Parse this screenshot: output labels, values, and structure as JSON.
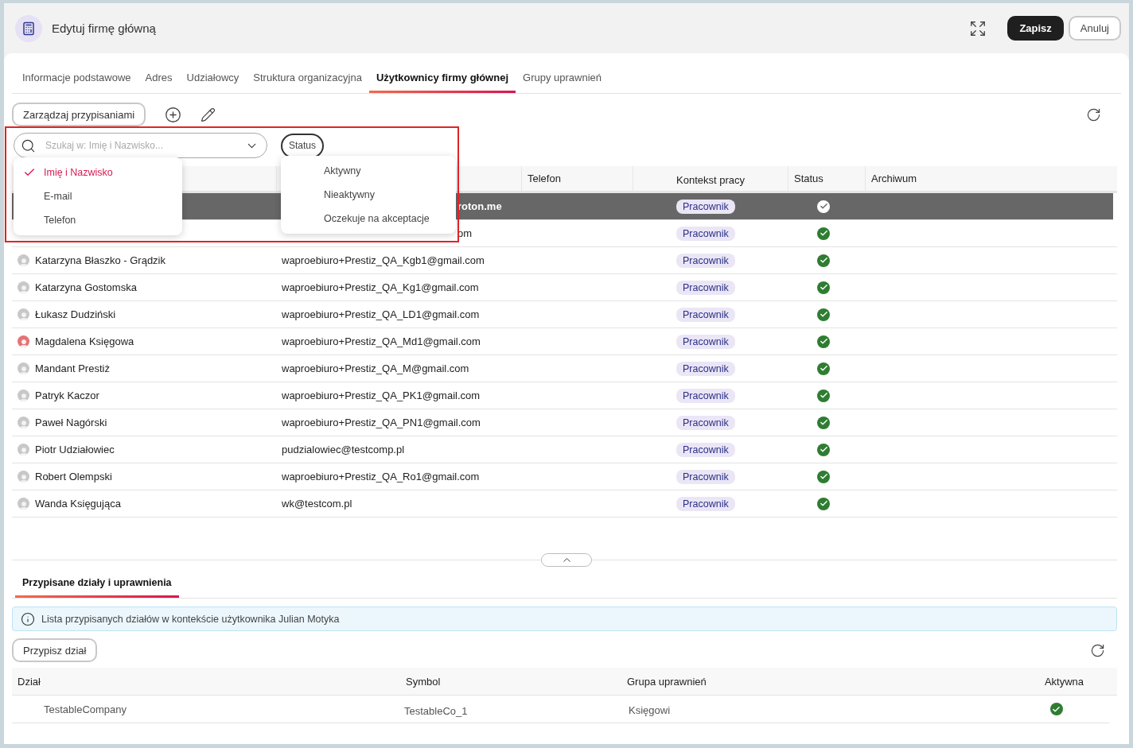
{
  "window": {
    "title": "Edytuj firmę główną",
    "buttons": [
      {
        "label": "Zapisz",
        "kind": "primary"
      },
      {
        "label": "Anuluj",
        "kind": "secondary"
      }
    ]
  },
  "tabs": [
    {
      "label": "Informacje podstawowe",
      "selected": false
    },
    {
      "label": "Adres",
      "selected": false
    },
    {
      "label": "Udziałowcy",
      "selected": false
    },
    {
      "label": "Struktura organizacyjna",
      "selected": false
    },
    {
      "label": "Użytkownicy firmy głównej",
      "selected": true
    },
    {
      "label": "Grupy uprawnień",
      "selected": false
    }
  ],
  "toolbar": {
    "manage_button": "Zarządzaj przypisaniami"
  },
  "search": {
    "placeholder": "Szukaj w: Imię i Nazwisko...",
    "options": [
      {
        "label": "Imię i Nazwisko",
        "selected": true
      },
      {
        "label": "E-mail",
        "selected": false
      },
      {
        "label": "Telefon",
        "selected": false
      }
    ]
  },
  "status_filter": {
    "label": "Status",
    "options": [
      {
        "label": "Aktywny",
        "selected": false
      },
      {
        "label": "Nieaktywny",
        "selected": false
      },
      {
        "label": "Oczekuje na akceptacje",
        "selected": false
      }
    ]
  },
  "users_table": {
    "columns": [
      {
        "label": "Telefon"
      },
      {
        "label": "Kontekst pracy"
      },
      {
        "label": "Status"
      },
      {
        "label": "Archiwum"
      }
    ],
    "rows": [
      {
        "email": "roton.me",
        "partially_hidden": true,
        "context": "Pracownik",
        "active": true,
        "selected": true
      },
      {
        "email": "om",
        "partially_hidden": true,
        "context": "Pracownik",
        "active": true,
        "selected": false
      },
      {
        "name": "Katarzyna Błaszko - Grądzik",
        "color": "#c8c8c8",
        "email": "waproebiuro+Prestiz_QA_Kgb1@gmail.com",
        "partially_hidden": false,
        "context": "Pracownik",
        "active": true,
        "selected": false
      },
      {
        "name": "Katarzyna Gostomska",
        "color": "#c8c8c8",
        "email": "waproebiuro+Prestiz_QA_Kg1@gmail.com",
        "partially_hidden": false,
        "context": "Pracownik",
        "active": true,
        "selected": false
      },
      {
        "name": "Łukasz Dudziński",
        "color": "#c8c8c8",
        "email": "waproebiuro+Prestiz_QA_LD1@gmail.com",
        "partially_hidden": false,
        "context": "Pracownik",
        "active": true,
        "selected": false
      },
      {
        "name": "Magdalena Księgowa",
        "color": "#e57373",
        "email": "waproebiuro+Prestiz_QA_Md1@gmail.com",
        "partially_hidden": false,
        "context": "Pracownik",
        "active": true,
        "selected": false
      },
      {
        "name": "Mandant Prestiż",
        "color": "#c8c8c8",
        "email": "waproebiuro+Prestiz_QA_M@gmail.com",
        "partially_hidden": false,
        "context": "Pracownik",
        "active": true,
        "selected": false
      },
      {
        "name": "Patryk Kaczor",
        "color": "#c8c8c8",
        "email": "waproebiuro+Prestiz_QA_PK1@gmail.com",
        "partially_hidden": false,
        "context": "Pracownik",
        "active": true,
        "selected": false
      },
      {
        "name": "Paweł Nagórski",
        "color": "#c8c8c8",
        "email": "waproebiuro+Prestiz_QA_PN1@gmail.com",
        "partially_hidden": false,
        "context": "Pracownik",
        "active": true,
        "selected": false
      },
      {
        "name": "Piotr Udziałowiec",
        "color": "#c8c8c8",
        "email": "pudzialowiec@testcomp.pl",
        "partially_hidden": false,
        "context": "Pracownik",
        "active": true,
        "selected": false
      },
      {
        "name": "Robert Olempski",
        "color": "#c8c8c8",
        "email": "waproebiuro+Prestiz_QA_Ro1@gmail.com",
        "partially_hidden": false,
        "context": "Pracownik",
        "active": true,
        "selected": false
      },
      {
        "name": "Wanda Księgująca",
        "color": "#c8c8c8",
        "email": "wk@testcom.pl",
        "partially_hidden": false,
        "context": "Pracownik",
        "active": true,
        "selected": false
      }
    ]
  },
  "bottom_tabs": [
    {
      "label": "Przypisane działy i uprawnienia",
      "selected": true
    }
  ],
  "info": "Lista przypisanych działów w kontekście użytkownika Julian Motyka",
  "assign_button": "Przypisz dział",
  "departments_table": {
    "columns": [
      "Dział",
      "Symbol",
      "Grupa uprawnień",
      "Aktywna"
    ],
    "rows": [
      {
        "department": "TestableCompany",
        "symbol": "TestableCo_1",
        "group": "Księgowi",
        "active": true
      }
    ]
  }
}
